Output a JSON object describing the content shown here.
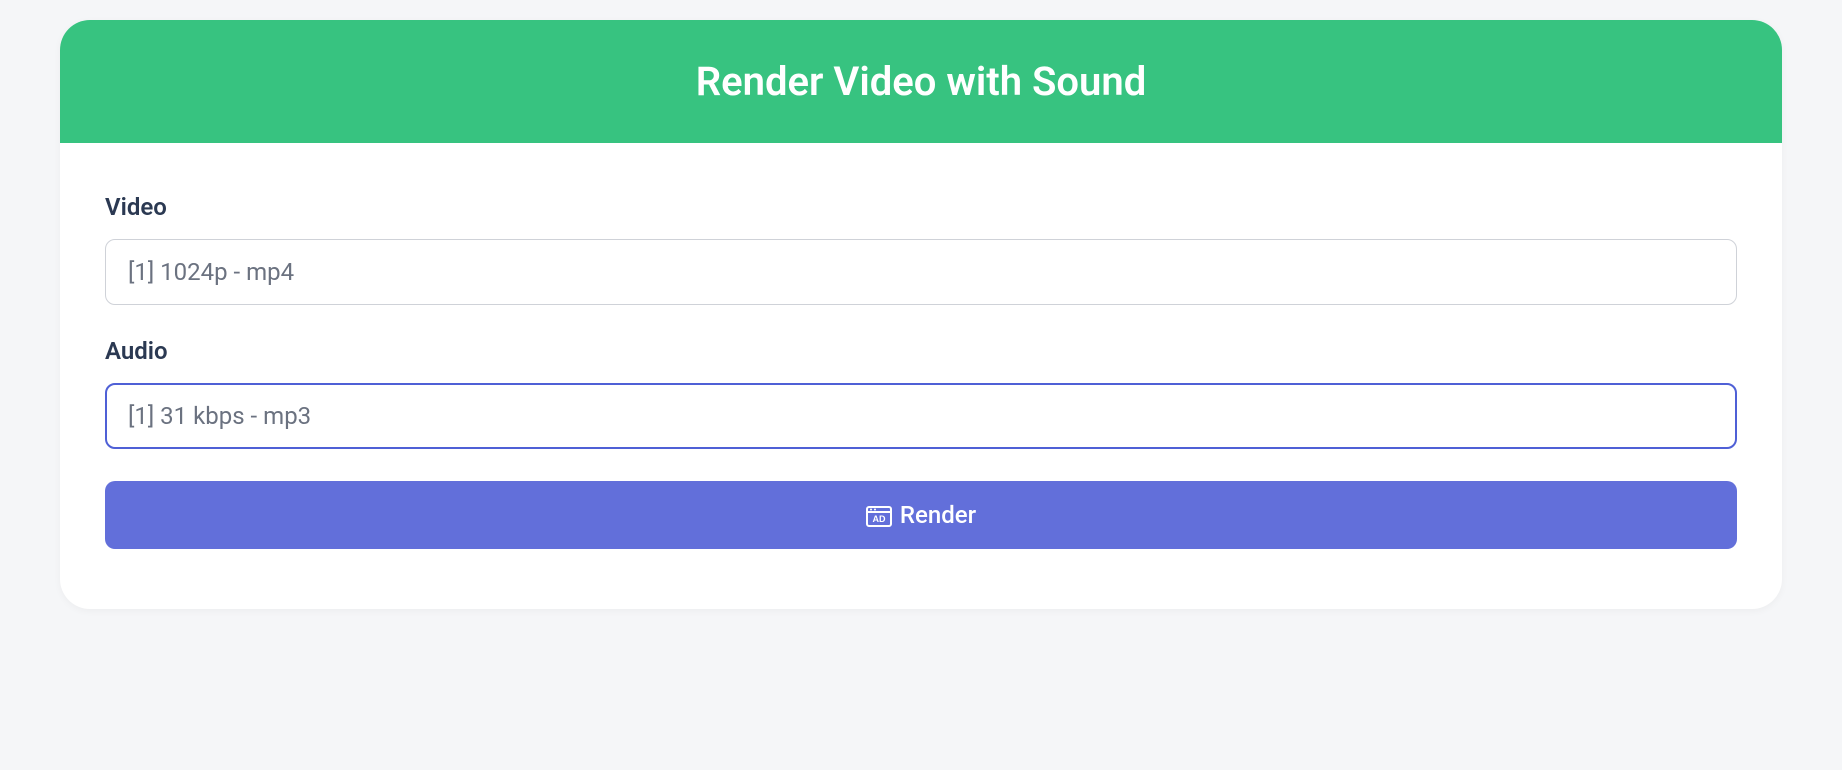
{
  "header": {
    "title": "Render Video with Sound"
  },
  "form": {
    "video": {
      "label": "Video",
      "value": "[1] 1024p - mp4"
    },
    "audio": {
      "label": "Audio",
      "value": "[1] 31 kbps - mp3"
    }
  },
  "button": {
    "label": "Render"
  },
  "colors": {
    "accent_green": "#37c380",
    "accent_purple": "#626fda",
    "focus_border": "#4f60d6"
  }
}
